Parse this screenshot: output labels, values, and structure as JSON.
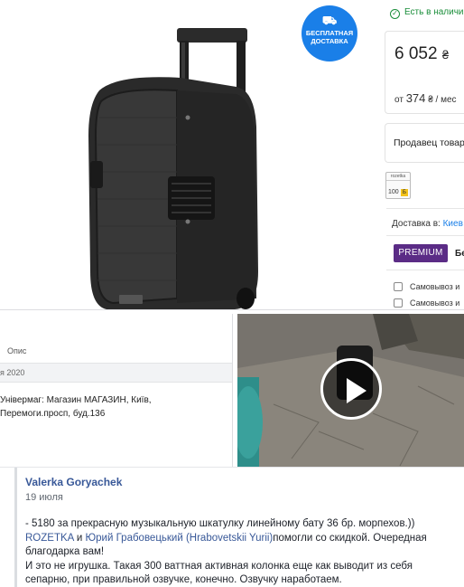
{
  "product": {
    "delivery_badge": {
      "line1": "БЕСПЛАТНАЯ",
      "line2": "ДОСТАВКА"
    },
    "stock_status": "Есть в наличии",
    "price": "6 052",
    "currency": "₴",
    "installment_prefix": "от",
    "installment_amount": "374",
    "installment_suffix": "₴ / мес",
    "seller_label": "Продавец товара",
    "rating_icon_label": "rozetka",
    "rating_score": "100",
    "rating_mark": "Б",
    "delivery_label": "Доставка в:",
    "delivery_city": "Киев",
    "premium_label": "PREMIUM",
    "premium_more": "Бе",
    "options": [
      "Самовывоз и",
      "Самовывоз и"
    ]
  },
  "listing": {
    "header_label": "Опис",
    "date_fragment": "я 2020",
    "address_line1": "Універмаг: Магазин МАГАЗИН, Київ,",
    "address_line2": "Перемоги.просп, буд.136"
  },
  "comment": {
    "author": "Valerka Goryachek",
    "date": "19 июля",
    "line1": "- 5180 за прекрасную музыкальную шкатулку линейному бату 36 бр. морпехов.))",
    "mention1": "ROZETKA",
    "and_word": "и",
    "mention2": "Юрий Грабовецький (Hrabovetskii Yurii)",
    "line2_rest": "помогли со скидкой. Очередная",
    "line3": "благодарка вам!",
    "line4": "И это не игрушка. Такая 300 ваттная активная колонка еще как выводит из себя",
    "line5": "сепарню, при правильной озвучке, конечно. Озвучку наработаем."
  },
  "colors": {
    "link": "#385898",
    "stock_green": "#1a8e3a",
    "badge_blue": "#1a7fe8",
    "premium_purple": "#5b2c86"
  }
}
